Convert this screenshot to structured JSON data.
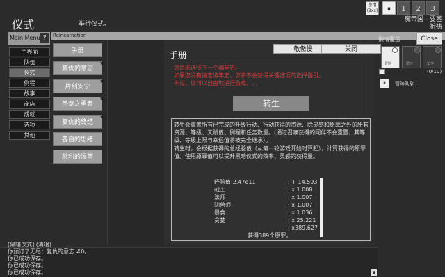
{
  "header": {
    "title": "仪式",
    "subtitle": "举行仪式。",
    "mood_label": "怠惰",
    "mood_value": "(9xx)",
    "speed_pause": "⏸",
    "speed_buttons": [
      "1",
      "2",
      "3"
    ],
    "realm_line1": "魔帝国 - 要塞",
    "realm_line2": "祈祷"
  },
  "main_menu": {
    "title": "Main Menu",
    "help": "?",
    "items": [
      "主界面",
      "队伍",
      "仪式",
      "例程",
      "故事",
      "商店",
      "成就",
      "选项",
      "其他"
    ],
    "active_index": 2
  },
  "panel_title": "Reincarnation",
  "list": {
    "items": [
      "手册",
      "复仇的意志",
      "片刻安宁",
      "圣剑之勇者",
      "复仇的终结",
      "各自的思绪",
      "胜利的渴望"
    ],
    "starred": [
      false,
      true,
      true,
      true,
      true,
      false,
      false
    ]
  },
  "content": {
    "title": "手册",
    "proud_button": "敬傲慢",
    "close_button": "关闭",
    "warnings": [
      "您尚未选择下一个编年史。",
      "如果您没有指定编年史，您将不会获得关键选项的选择指引。",
      "不过，您可以自由地进行游戏。..."
    ],
    "rebirth_button": "转生",
    "description_1": "转生会重置所有已完成的升级行动、行动获得的资源、除灵感和原罪之外的所有资源、等级、天赋值、例程和任务数量。(通过召唤获得的同伴不会重置，其等级、等级上限与幸运值将被完全继承）。",
    "description_2": "转生时，会根据获得的总经验值（从第一轮游戏开始时算起），计算获得的原罪值。使用原罪值可以提升黑暗仪式的效率、灵感的获得量。",
    "stats": [
      {
        "label": "经验值:2.47e11",
        "value": ": + 14.593"
      },
      {
        "label": "战士",
        "value": ": x 1.008"
      },
      {
        "label": "法师",
        "value": ": x 1.007"
      },
      {
        "label": "驯兽师",
        "value": ": x 1.007"
      },
      {
        "label": "暴食",
        "value": ": x 1.036"
      },
      {
        "label": "贪婪",
        "value": ": x 25.221"
      }
    ],
    "total": ": x389.627",
    "result": "获得389个原罪。"
  },
  "right_panel": {
    "title": "懒惰覆盖",
    "close": "Close",
    "slots": [
      "冒险",
      "循环",
      "工作"
    ],
    "count": "(0/10)",
    "pause": "⏸",
    "queue": "冒险队列"
  },
  "log": {
    "lines": [
      "[黑暗仪式] (清退)",
      "你预订了无尽：复仇的意志 #0。",
      "你已成功保存。",
      "你已成功保存。",
      "你已成功保存。"
    ],
    "scroll": "▲"
  }
}
